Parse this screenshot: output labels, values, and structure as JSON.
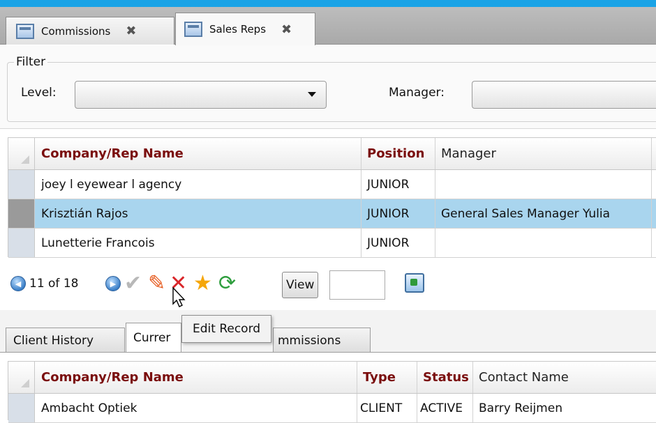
{
  "tabs": [
    {
      "label": "Commissions",
      "active": false
    },
    {
      "label": "Sales Reps",
      "active": true
    }
  ],
  "filter": {
    "legend": "Filter",
    "level_label": "Level:",
    "level_value": "",
    "manager_label": "Manager:",
    "manager_value": ""
  },
  "reps_grid": {
    "columns": [
      "Company/Rep Name",
      "Position",
      "Manager"
    ],
    "rows": [
      {
        "name": "joey l eyewear l agency",
        "position": "JUNIOR",
        "manager": ""
      },
      {
        "name": "Krisztián Rajos",
        "position": "JUNIOR",
        "manager": "General Sales Manager Yulia",
        "selected": true
      },
      {
        "name": "Lunetterie Francois",
        "position": "JUNIOR",
        "manager": ""
      }
    ]
  },
  "navigator": {
    "position_text": "11 of 18",
    "view_label": "View",
    "page_input": "",
    "tooltip": "Edit Record"
  },
  "lower_tabs": [
    {
      "label": "Client History",
      "active": false
    },
    {
      "label": "Currer",
      "active": true
    },
    {
      "label": "mmissions",
      "active": false
    }
  ],
  "clients_grid": {
    "columns": [
      "Company/Rep Name",
      "Type",
      "Status",
      "Contact Name"
    ],
    "rows": [
      {
        "name": "Ambacht Optiek",
        "type": "CLIENT",
        "status": "ACTIVE",
        "contact": "Barry Reijmen"
      }
    ]
  },
  "colors": {
    "accent_bar": "#1aa3e6",
    "header_text": "#7a0d0d",
    "selected_row": "#a9d5ee"
  },
  "icons": [
    "document-icon",
    "close-icon",
    "previous-icon",
    "next-icon",
    "save-check-icon",
    "edit-pencil-icon",
    "delete-x-icon",
    "new-star-icon",
    "refresh-icon",
    "export-icon",
    "mouse-cursor-icon",
    "dropdown-arrow-icon"
  ]
}
